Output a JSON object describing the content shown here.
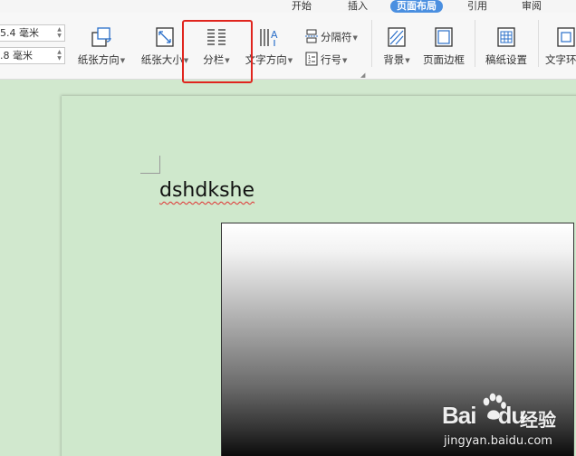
{
  "tabs": [
    {
      "label": "开始",
      "active": false
    },
    {
      "label": "插入",
      "active": false
    },
    {
      "label": "页面布局",
      "active": true
    },
    {
      "label": "引用",
      "active": false
    },
    {
      "label": "审阅",
      "active": false
    }
  ],
  "ribbon": {
    "margin_top_value": "5.4 毫米",
    "margin_bottom_value": ".8 毫米",
    "orientation_label": "纸张方向",
    "size_label": "纸张大小",
    "columns_label": "分栏",
    "text_direction_label": "文字方向",
    "breaks_label": "分隔符",
    "line_numbers_label": "行号",
    "background_label": "背景",
    "page_border_label": "页面边框",
    "manuscript_label": "稿纸设置",
    "text_wrap_label": "文字环"
  },
  "document": {
    "body_text": "dshdkshe"
  },
  "watermark": {
    "logo_text": "Bai",
    "logo_text_2": "du",
    "cn_text": "经验",
    "url_text": "jingyan.baidu.com"
  },
  "colors": {
    "active_tab": "#4a8fe0",
    "highlight_box": "#e0251e",
    "document_background": "#cfe8cc",
    "spellcheck_underline": "#e03030"
  }
}
